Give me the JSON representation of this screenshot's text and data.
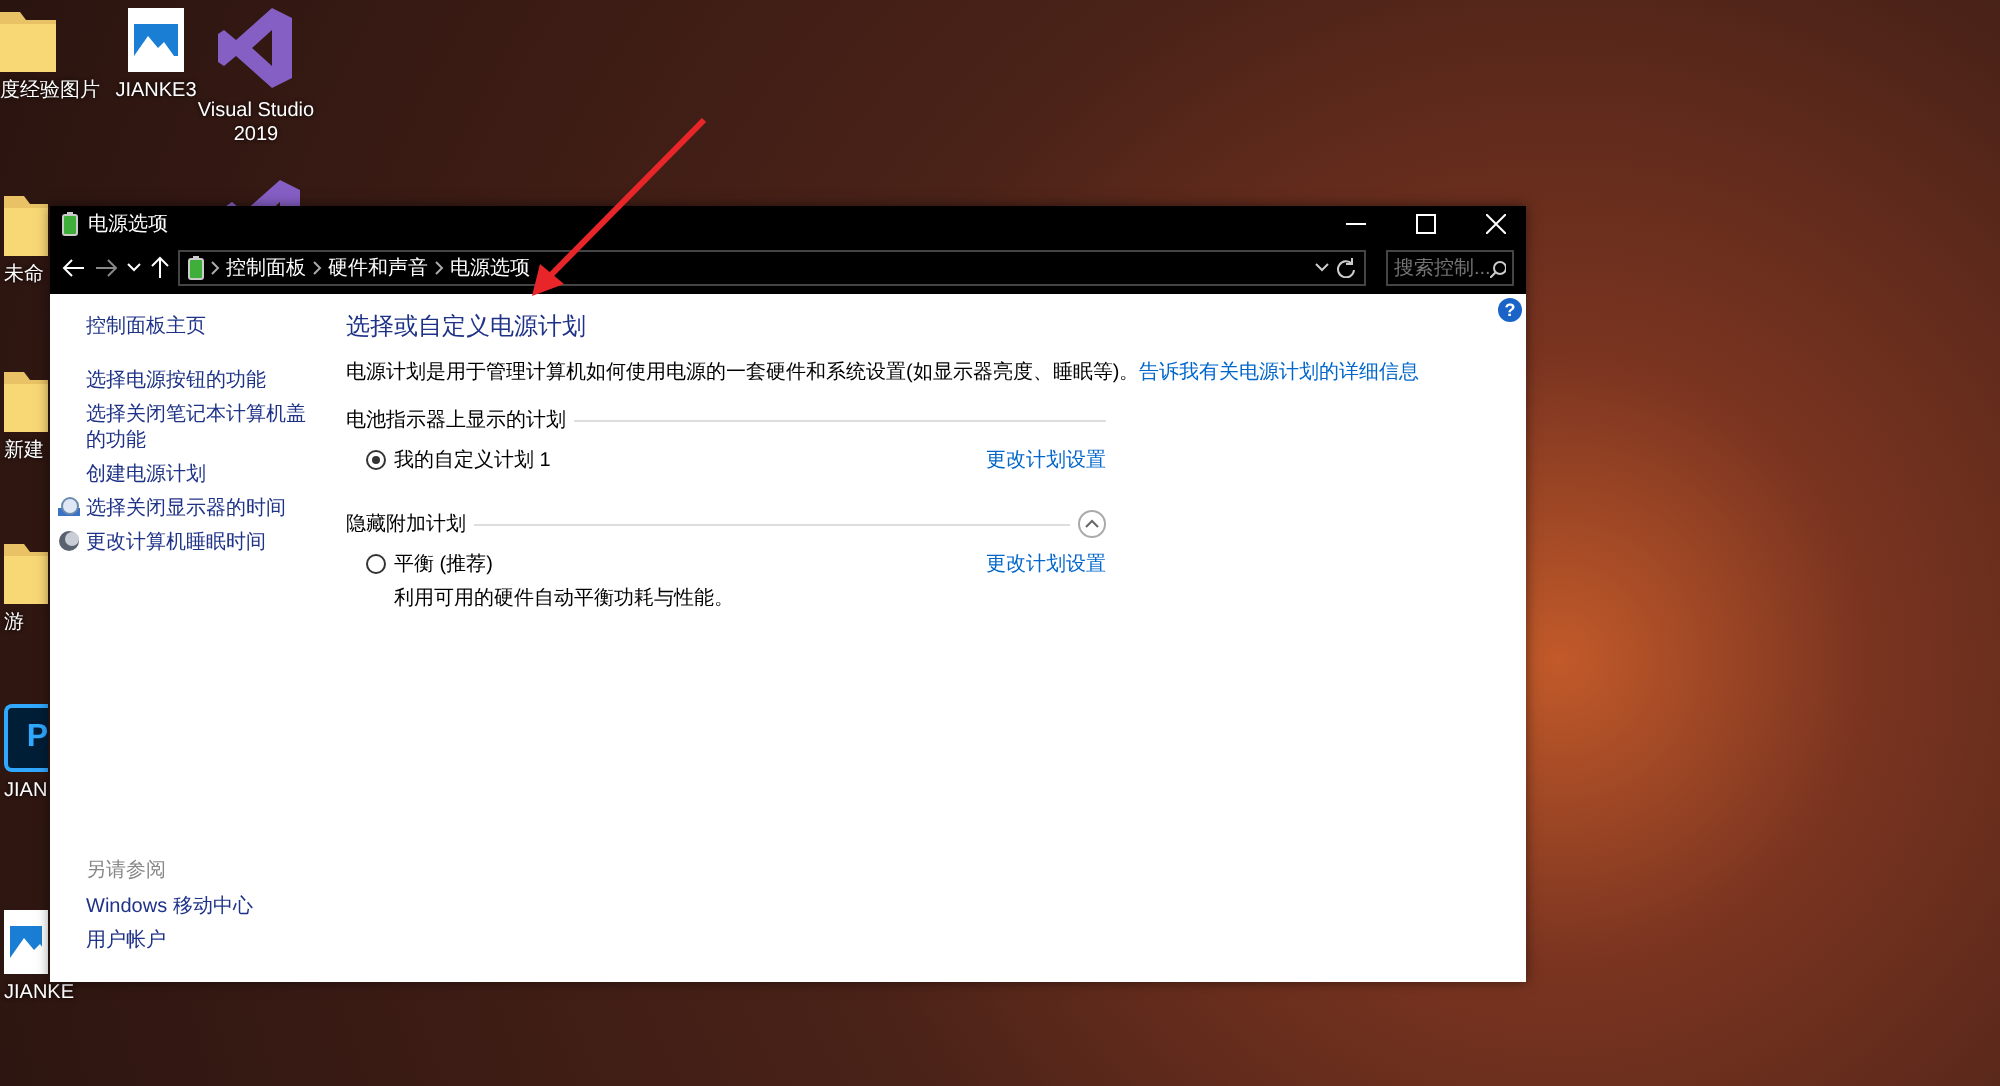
{
  "desktop_icons": [
    {
      "kind": "folder",
      "label": "度经验图片"
    },
    {
      "kind": "image",
      "label": "JIANKE3"
    },
    {
      "kind": "vs",
      "label": "Visual Studio 2019"
    },
    {
      "kind": "vs"
    },
    {
      "kind": "folder",
      "label": "未命"
    },
    {
      "kind": "folder",
      "label": "新建"
    },
    {
      "kind": "folder",
      "label": "游"
    },
    {
      "kind": "ps",
      "badge": "P",
      "label": "JIAN"
    },
    {
      "kind": "image",
      "label": "JIANKE"
    }
  ],
  "window": {
    "title": "电源选项",
    "address_bar": {
      "breadcrumb": [
        "控制面板",
        "硬件和声音",
        "电源选项"
      ]
    },
    "search": {
      "placeholder": "搜索控制..."
    },
    "sidebar": {
      "home": "控制面板主页",
      "items": [
        {
          "kind": "plain",
          "label": "选择电源按钮的功能"
        },
        {
          "kind": "plain",
          "label": "选择关闭笔记本计算机盖的功能"
        },
        {
          "kind": "plain",
          "label": "创建电源计划"
        },
        {
          "kind": "monitor",
          "label": "选择关闭显示器的时间"
        },
        {
          "kind": "sleep",
          "label": "更改计算机睡眠时间"
        }
      ],
      "see_also": {
        "heading": "另请参阅",
        "links": [
          "Windows 移动中心",
          "用户帐户"
        ]
      }
    },
    "help": "?",
    "main": {
      "title": "选择或自定义电源计划",
      "description": "电源计划是用于管理计算机如何使用电源的一套硬件和系统设置(如显示器亮度、睡眠等)。",
      "link": "告诉我有关电源计划的详细信息",
      "groups": [
        {
          "heading": "电池指示器上显示的计划",
          "collapsible": false,
          "plans": [
            {
              "name": "我的自定义计划 1",
              "selected": true,
              "action": "更改计划设置"
            }
          ]
        },
        {
          "heading": "隐藏附加计划",
          "collapsible": true,
          "expanded": true,
          "plans": [
            {
              "name": "平衡 (推荐)",
              "selected": false,
              "description": "利用可用的硬件自动平衡功耗与性能。",
              "action": "更改计划设置"
            }
          ]
        }
      ]
    }
  }
}
